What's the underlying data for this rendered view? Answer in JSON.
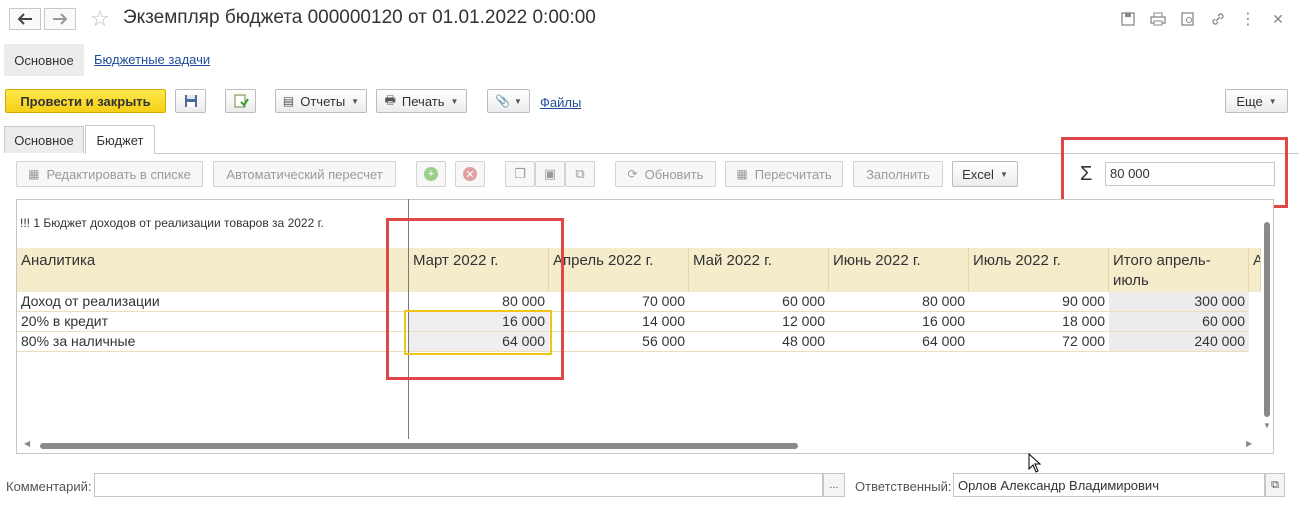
{
  "window": {
    "title": "Экземпляр бюджета 000000120 от 01.01.2022 0:00:00",
    "back_icon": "arrow-left-icon",
    "forward_icon": "arrow-right-icon",
    "favorite_icon": "star-icon",
    "icons": [
      "save-icon",
      "print-icon",
      "preview-icon",
      "link-icon",
      "more-icon",
      "close-icon"
    ]
  },
  "nav": {
    "main": "Основное",
    "budget_tasks": "Бюджетные задачи"
  },
  "commands": {
    "post_close": "Провести и закрыть",
    "reports": "Отчеты",
    "print": "Печать",
    "files": "Файлы",
    "more": "Еще"
  },
  "tabs": [
    {
      "label": "Основное"
    },
    {
      "label": "Бюджет"
    }
  ],
  "budget_toolbar": {
    "edit_in_list": "Редактировать в списке",
    "auto_recalc": "Автоматический пересчет",
    "refresh": "Обновить",
    "recalculate": "Пересчитать",
    "fill": "Заполнить",
    "excel": "Excel"
  },
  "sum": {
    "symbol": "Σ",
    "value": "80 000"
  },
  "grid": {
    "caption": "!!! 1 Бюджет доходов от реализации товаров за 2022 г.",
    "headers": [
      "Аналитика",
      "Март 2022 г.",
      "Апрель 2022 г.",
      "Май 2022 г.",
      "Июнь 2022 г.",
      "Июль 2022 г.",
      "Итого апрель-июль",
      "А"
    ],
    "rows": [
      {
        "name": "Доход от реализации",
        "values": [
          "80 000",
          "70 000",
          "60 000",
          "80 000",
          "90 000",
          "300 000"
        ]
      },
      {
        "name": "20% в кредит",
        "values": [
          "16 000",
          "14 000",
          "12 000",
          "16 000",
          "18 000",
          "60 000"
        ]
      },
      {
        "name": "80% за наличные",
        "values": [
          "64 000",
          "56 000",
          "48 000",
          "64 000",
          "72 000",
          "240 000"
        ]
      }
    ]
  },
  "footer": {
    "comment_label": "Комментарий:",
    "comment_value": "",
    "comment_button": "...",
    "responsible_label": "Ответственный:",
    "responsible_value": "Орлов Александр Владимирович"
  },
  "colors": {
    "accent_yellow": "#f6cf18",
    "header_bg": "#f5eccb",
    "highlight_red": "#e04848",
    "selection_yellow": "#f0c419",
    "link": "#1f4e98"
  }
}
